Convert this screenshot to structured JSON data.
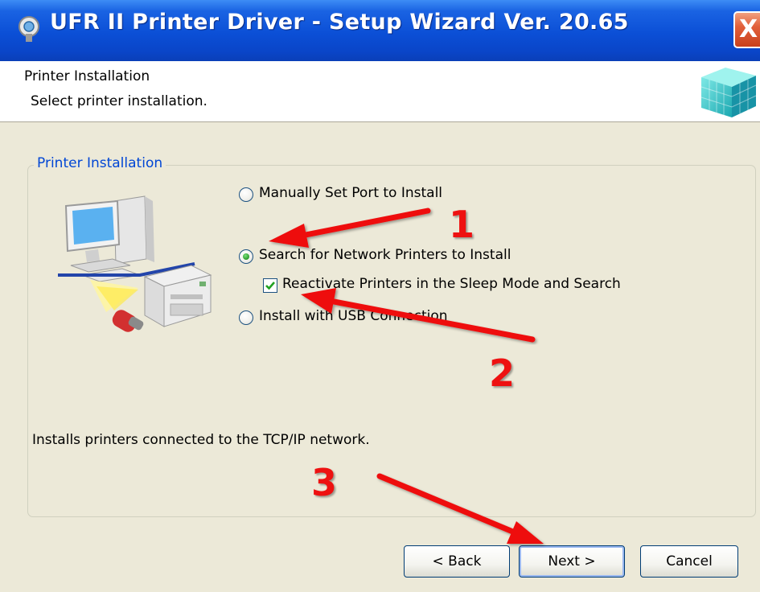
{
  "window": {
    "title": "UFR II Printer Driver - Setup Wizard Ver. 20.65",
    "close_label": "X"
  },
  "header": {
    "title": "Printer Installation",
    "subtitle": "Select printer installation."
  },
  "group": {
    "label": "Printer Installation",
    "options": [
      {
        "label": "Manually Set Port to Install",
        "selected": false
      },
      {
        "label": "Search for Network Printers to Install",
        "selected": true
      },
      {
        "label": "Install with USB Connection",
        "selected": false
      }
    ],
    "checkbox": {
      "label": "Reactivate Printers in the Sleep Mode and Search",
      "checked": true
    },
    "description": "Installs printers connected to the TCP/IP network."
  },
  "buttons": {
    "back": "< Back",
    "next": "Next >",
    "cancel": "Cancel"
  },
  "annotations": {
    "step1": "1",
    "step2": "2",
    "step3": "3",
    "color": "#ee1111"
  },
  "icons": [
    "setup-icon",
    "close-icon",
    "cube-logo-icon",
    "computer-printer-illustration"
  ]
}
